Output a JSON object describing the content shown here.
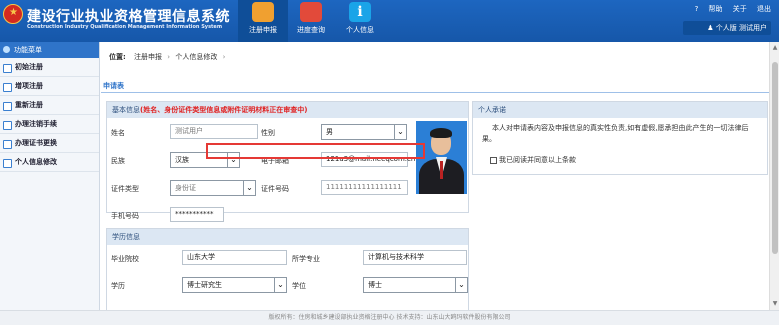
{
  "header": {
    "title": "建设行业执业资格管理信息系统",
    "subtitle": "Construction Industry Qualification Management Information System",
    "tabs": [
      {
        "label": "注册申报",
        "icon": "register-icon"
      },
      {
        "label": "进度查询",
        "icon": "monitor-icon"
      },
      {
        "label": "个人信息",
        "icon": "info-icon",
        "glyph": "i"
      }
    ],
    "links": [
      "帮助",
      "关于",
      "退出"
    ],
    "help_glyph": "?",
    "user_prefix": "个人版",
    "user_name": "测试用户"
  },
  "sidebar": {
    "title": "功能菜单",
    "items": [
      {
        "label": "初始注册"
      },
      {
        "label": "增项注册"
      },
      {
        "label": "重新注册"
      },
      {
        "label": "办理注销手续"
      },
      {
        "label": "办理证书更换"
      },
      {
        "label": "个人信息修改"
      }
    ]
  },
  "breadcrumb": {
    "label": "位置:",
    "items": [
      "注册申报",
      "个人信息修改"
    ]
  },
  "form": {
    "section_title": "申请表",
    "basic": {
      "title": "基本信息",
      "warning": "(姓名、身份证件类型信息或附件证明材料正在审查中)",
      "name_label": "姓名",
      "name_value": "测试用户",
      "gender_label": "性别",
      "gender_value": "男",
      "ethnicity_label": "民族",
      "ethnicity_value": "汉族",
      "email_label": "电子邮箱",
      "email_value": "121a3@mail.neeqcom.cn",
      "id_type_label": "证件类型",
      "id_type_value": "身份证",
      "id_number_label": "证件号码",
      "id_number_value": "11111111111111111",
      "phone_label": "手机号码",
      "phone_value": "***********"
    },
    "education": {
      "title": "学历信息",
      "school_label": "毕业院校",
      "school_value": "山东大学",
      "major_label": "所学专业",
      "major_value": "计算机与技术科学",
      "edu_label": "学历",
      "edu_value": "博士研究生",
      "degree_label": "学位",
      "degree_value": "博士"
    }
  },
  "pledge": {
    "title": "个人承诺",
    "text": "本人对申请表内容及申报信息的真实性负责,如有虚假,愿承担由此产生的一切法律后果。",
    "checkbox_label": "我已阅读并同意以上条款"
  },
  "footer": {
    "text": "版权所有：住房和城乡建设部执业资格注册中心    技术支持：山东山大鸥玛软件股份有限公司"
  },
  "colors": {
    "header_blue": "#1d66c0",
    "highlight_red": "#e53935",
    "warning_red": "#e02020"
  }
}
